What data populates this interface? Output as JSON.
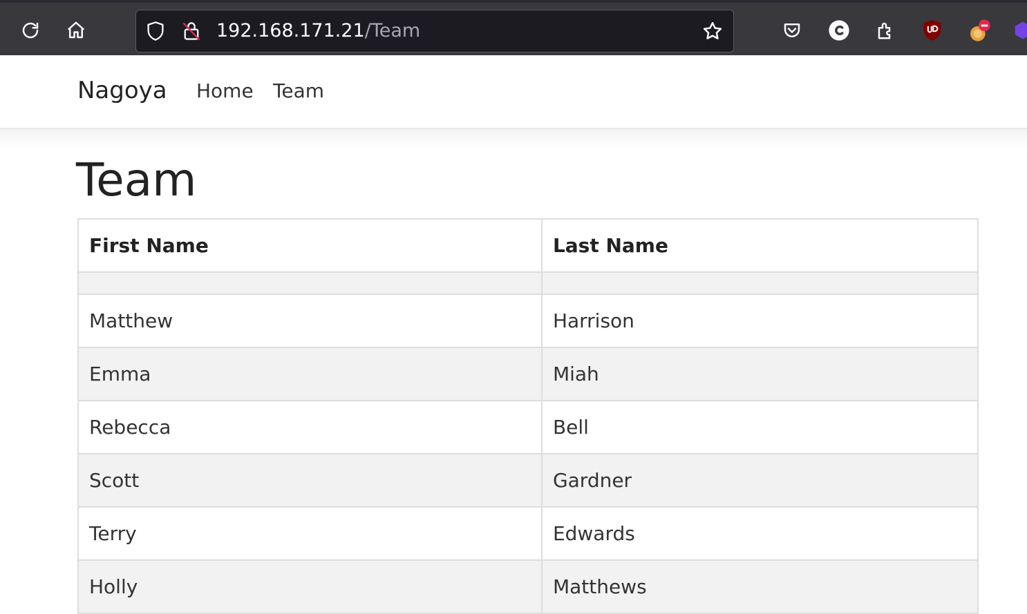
{
  "browser": {
    "url_host": "192.168.171.21",
    "url_path": "/Team"
  },
  "navbar": {
    "brand": "Nagoya",
    "links": [
      "Home",
      "Team"
    ]
  },
  "page": {
    "title": "Team"
  },
  "table": {
    "headers": [
      "First Name",
      "Last Name"
    ],
    "rows": [
      [
        "",
        ""
      ],
      [
        "Matthew",
        "Harrison"
      ],
      [
        "Emma",
        "Miah"
      ],
      [
        "Rebecca",
        "Bell"
      ],
      [
        "Scott",
        "Gardner"
      ],
      [
        "Terry",
        "Edwards"
      ],
      [
        "Holly",
        "Matthews"
      ]
    ]
  },
  "colors": {
    "toolbar_bg": "#38383d",
    "urlbar_bg": "#1c1b22",
    "stripe_bg": "#f2f2f2",
    "border": "#dddddd",
    "ublock_red": "#800000"
  },
  "icons": {
    "toolbar": [
      "reload-icon",
      "home-icon"
    ],
    "urlbar": [
      "shield-icon",
      "insecure-lock-icon",
      "bookmark-star-icon"
    ],
    "extensions": [
      "pocket-icon",
      "c-extension-icon",
      "extensions-puzzle-icon",
      "ublock-origin-icon",
      "extension-blocked-icon",
      "purple-extension-icon"
    ]
  }
}
